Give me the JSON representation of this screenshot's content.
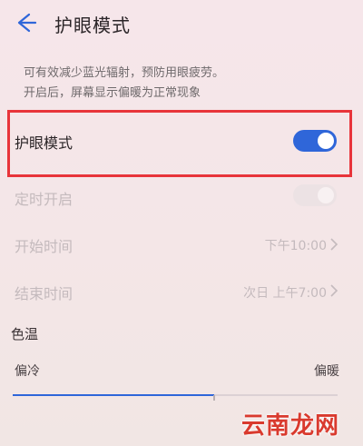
{
  "header": {
    "title": "护眼模式",
    "back_icon": "arrow-left-icon"
  },
  "description": {
    "line1": "可有效减少蓝光辐射，预防用眼疲劳。",
    "line2": "开启后，屏幕显示偏暖为正常现象"
  },
  "settings": {
    "eye_comfort": {
      "label": "护眼模式",
      "enabled": true
    },
    "scheduled": {
      "label": "定时开启",
      "enabled": false
    },
    "start_time": {
      "label": "开始时间",
      "value": "下午10:00"
    },
    "end_time": {
      "label": "结束时间",
      "value": "次日 上午7:00"
    }
  },
  "color_temperature": {
    "title": "色温",
    "min_label": "偏冷",
    "max_label": "偏暖",
    "level": 0.62
  },
  "watermark": "云南龙网",
  "colors": {
    "accent": "#2f66d9",
    "highlight": "#e8343a",
    "background": "#f4e6e8",
    "disabled_text": "#c4babd"
  }
}
